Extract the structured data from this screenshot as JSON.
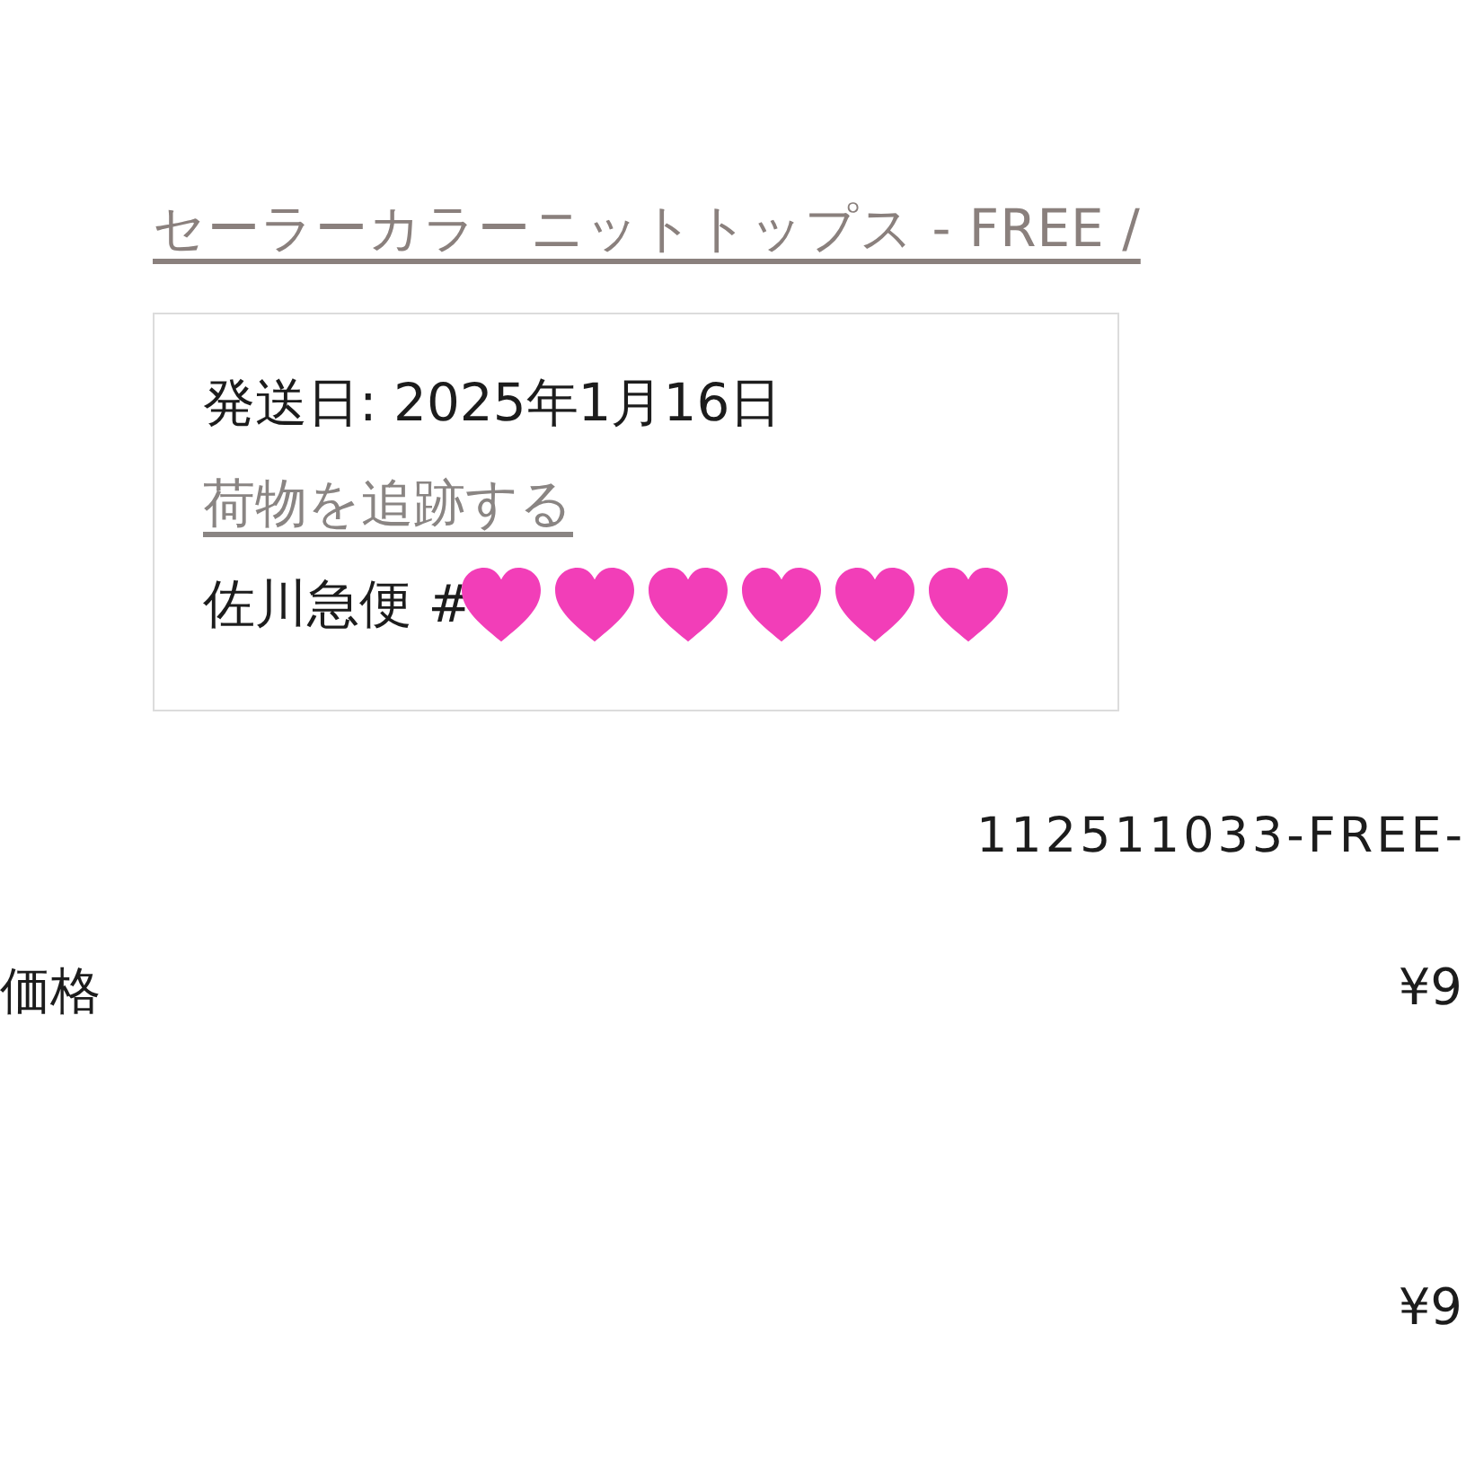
{
  "product_title": "セーラーカラーニットトップス - FREE /",
  "shipment": {
    "ship_date": "発送日: 2025年1月16日",
    "track_link": "荷物を追跡する",
    "carrier": "佐川急便 #"
  },
  "sku": "112511033-FREE-",
  "price_row": {
    "label": "価格",
    "value": "¥9"
  },
  "total_value": "¥9"
}
